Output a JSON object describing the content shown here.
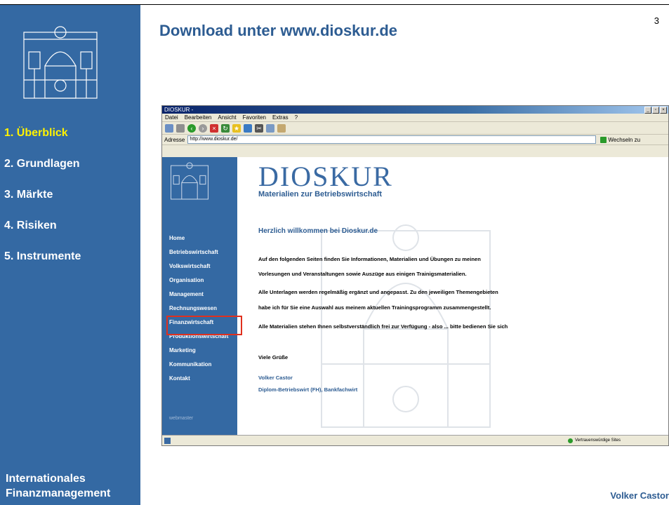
{
  "slide": {
    "page_number": "3",
    "title": "Download unter www.dioskur.de",
    "author": "Volker Castor",
    "course": [
      "Internationales",
      "Finanzmanagement"
    ],
    "nav": [
      {
        "label": "1. Überblick",
        "active": true
      },
      {
        "label": "2. Grundlagen",
        "active": false
      },
      {
        "label": "3. Märkte",
        "active": false
      },
      {
        "label": "4. Risiken",
        "active": false
      },
      {
        "label": "5. Instrumente",
        "active": false
      }
    ],
    "colors": {
      "sidebar": "#3469a3",
      "active_nav": "#fff200",
      "title": "#2d5c92"
    }
  },
  "browser": {
    "window_title": "DIOSKUR -",
    "menu": [
      "Datei",
      "Bearbeiten",
      "Ansicht",
      "Favoriten",
      "Extras",
      "?"
    ],
    "address_label": "Adresse",
    "url": "http://www.dioskur.de/",
    "go_label": "Wechseln zu",
    "status_zone": "Vertrauenswürdige Sites"
  },
  "website": {
    "brand": "DIOSKUR",
    "tagline": "Materialien zur Betriebswirtschaft",
    "nav": [
      "Home",
      "Betriebswirtschaft",
      "Volkswirtschaft",
      "Organisation",
      "Management",
      "Rechnungswesen",
      "Finanzwirtschaft",
      "Produktionswirtschaft",
      "Marketing",
      "Kommunikation",
      "Kontakt"
    ],
    "highlighted_nav": "Finanzwirtschaft",
    "webmaster": "webmaster",
    "welcome": "Herzlich willkommen bei Dioskur.de",
    "paragraphs": [
      "Auf den folgenden Seiten finden Sie Informationen, Materialien und Übungen zu meinen",
      "Vorlesungen und Veranstaltungen sowie Auszüge aus einigen Trainigsmaterialien.",
      "Alle Unterlagen werden regelmäßig ergänzt und angepasst. Zu den jeweiligen Themengebieten",
      "habe ich für Sie eine Auswahl aus meinem aktuellen Trainingsprogramm zusammengestellt.",
      "Alle Materialien stehen Ihnen selbstverständlich frei zur Verfügung - also ... bitte bedienen Sie sich"
    ],
    "greeting": "Viele Grüße",
    "signature_name": "Volker Castor",
    "signature_title": "Diplom-Betriebswirt (FH), Bankfachwirt"
  }
}
